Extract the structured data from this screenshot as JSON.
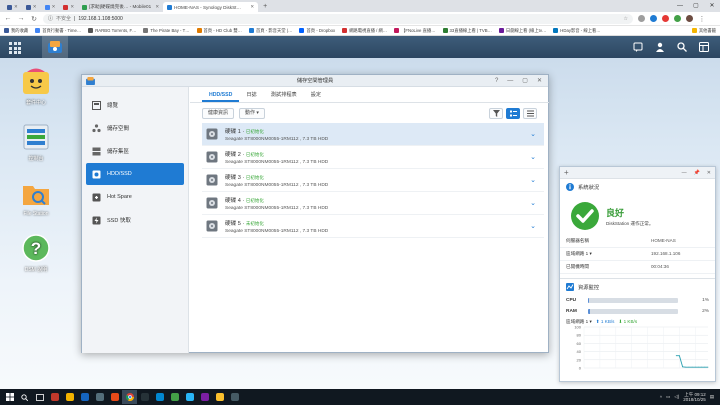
{
  "browser": {
    "tabs": [
      {
        "label": "",
        "color": "#3b5998",
        "active": false
      },
      {
        "label": "",
        "color": "#3b5998",
        "active": false
      },
      {
        "label": "",
        "color": "#4285f4",
        "active": false
      },
      {
        "label": "",
        "color": "#d32f2f",
        "active": false
      },
      {
        "label": "[求助]硬碟燒完後… - Mobile01",
        "color": "#2e9e4f",
        "active": false
      },
      {
        "label": "HOME-NAS - Synology DiskSt…",
        "color": "#1f7bd3",
        "active": true
      }
    ],
    "new_tab": "+",
    "window_controls": [
      "—",
      "▢",
      "✕"
    ],
    "security": "不安全",
    "url": "192.168.1.108:5000",
    "bookmarks": [
      {
        "label": "我的收藏",
        "color": "#3b5998"
      },
      {
        "label": "首頁行動書 - Time…",
        "color": "#4285f4"
      },
      {
        "label": "RARBG Torrents, F…",
        "color": "#555555"
      },
      {
        "label": "The Pirate Bay - T…",
        "color": "#777777"
      },
      {
        "label": "首頁 - HD Club 雙…",
        "color": "#e07b00"
      },
      {
        "label": "首頁 - 影音天堂 (…",
        "color": "#1f7bd3"
      },
      {
        "label": "首頁 - Dropbox",
        "color": "#0061ff"
      },
      {
        "label": "網路電視直播 / 網…",
        "color": "#d32f2f"
      },
      {
        "label": "【FNoLive 直播…",
        "color": "#c2185b"
      },
      {
        "label": "33直播線上看 | TVB…",
        "color": "#2e7d32"
      },
      {
        "label": "日劇線上看 (線上tv…",
        "color": "#6a1b9a"
      },
      {
        "label": "HDay影音 - 線上看…",
        "color": "#0277bd"
      },
      {
        "label": "其他書籤",
        "color": "#f4b400"
      }
    ]
  },
  "desktop": {
    "icons": [
      {
        "label": "套件中心"
      },
      {
        "label": "控制台"
      },
      {
        "label": "File Station"
      },
      {
        "label": "DSM 說明"
      }
    ]
  },
  "window": {
    "title": "儲存空間管理員",
    "controls": [
      "?",
      "—",
      "▢",
      "✕"
    ],
    "sidebar": [
      {
        "label": "總覽",
        "icon": "overview-icon",
        "selected": false
      },
      {
        "label": "儲存空間",
        "icon": "volume-icon",
        "selected": false
      },
      {
        "label": "儲存集區",
        "icon": "storage-pool-icon",
        "selected": false
      },
      {
        "label": "HDD/SSD",
        "icon": "hdd-icon",
        "selected": true
      },
      {
        "label": "Hot Spare",
        "icon": "hot-spare-icon",
        "selected": false
      },
      {
        "label": "SSD 快取",
        "icon": "ssd-cache-icon",
        "selected": false
      }
    ],
    "tabs": [
      {
        "label": "HDD/SSD",
        "selected": true
      },
      {
        "label": "日誌",
        "selected": false
      },
      {
        "label": "測試排程表",
        "selected": false
      },
      {
        "label": "設定",
        "selected": false
      }
    ],
    "toolbar": {
      "health_info": "健康資訊",
      "action": "動作 ▾"
    },
    "disks": [
      {
        "name": "硬碟 1",
        "status": "已初始化",
        "detail": "Seagate ST8000NM0055-1RM112 , 7.3 TB HDD",
        "selected": true
      },
      {
        "name": "硬碟 2",
        "status": "已初始化",
        "detail": "Seagate ST8000NM0055-1RM112 , 7.3 TB HDD",
        "selected": false
      },
      {
        "name": "硬碟 3",
        "status": "已初始化",
        "detail": "Seagate ST8000NM0055-1RM112 , 7.3 TB HDD",
        "selected": false
      },
      {
        "name": "硬碟 4",
        "status": "已初始化",
        "detail": "Seagate ST8000NM0055-1RM112 , 7.3 TB HDD",
        "selected": false
      },
      {
        "name": "硬碟 5",
        "status": "未初始化",
        "detail": "Seagate ST8000NM0055-1RM112 , 7.3 TB HDD",
        "selected": false
      }
    ]
  },
  "widget": {
    "controls": {
      "add": "+",
      "minimize": "—",
      "pin": "📌",
      "close": "✕"
    },
    "system_health": {
      "title": "系統狀況",
      "status": "良好",
      "subtitle": "DiskStation 運作正常。",
      "rows": [
        {
          "key": "伺服器名稱",
          "value": "HOME-NAS"
        },
        {
          "key": "區域網路 1 ▾",
          "value": "192.168.1.106"
        },
        {
          "key": "已開機時間",
          "value": "00:04:36"
        }
      ]
    },
    "resource_monitor": {
      "title": "資源監控",
      "cpu": {
        "label": "CPU",
        "percent": 1
      },
      "ram": {
        "label": "RAM",
        "percent": 2
      },
      "lan": {
        "label": "區域網路 1 ▾",
        "up": "⬆ 1 KB/s",
        "down": "⬇ 1 KB/s"
      }
    }
  },
  "chart_data": {
    "type": "line",
    "x": [
      0,
      1,
      2,
      3,
      4,
      5,
      6,
      7,
      8,
      9,
      10,
      11,
      12,
      13,
      14,
      15,
      16,
      17,
      18,
      19,
      20,
      21,
      22,
      23,
      24,
      25,
      26,
      27,
      28,
      29,
      30,
      31,
      32,
      33,
      34,
      35,
      36,
      37,
      38,
      39
    ],
    "series": [
      {
        "values": [
          null,
          null,
          null,
          null,
          null,
          null,
          null,
          null,
          null,
          null,
          null,
          null,
          null,
          null,
          null,
          null,
          null,
          null,
          null,
          null,
          null,
          null,
          null,
          null,
          null,
          null,
          null,
          null,
          null,
          30,
          30,
          3,
          2,
          2,
          2,
          2,
          2,
          2,
          2,
          2
        ],
        "color": "#2aa0b0"
      }
    ],
    "y_ticks": [
      100,
      80,
      60,
      40,
      20,
      0
    ],
    "ylim": [
      0,
      100
    ],
    "grid": true
  },
  "taskbar": {
    "apps": [
      "start",
      "search",
      "task-view",
      "app-1",
      "file-explorer",
      "app-2",
      "app-3",
      "app-4",
      "chrome",
      "app-5",
      "app-6",
      "app-7",
      "app-8",
      "app-9",
      "app-10",
      "app-11"
    ],
    "time": "上午 09:12",
    "date": "2018/10/25"
  },
  "colors": {
    "accent": "#1f7bd3",
    "ok": "#3aa83a",
    "dsm_bar": "#2c4661"
  }
}
